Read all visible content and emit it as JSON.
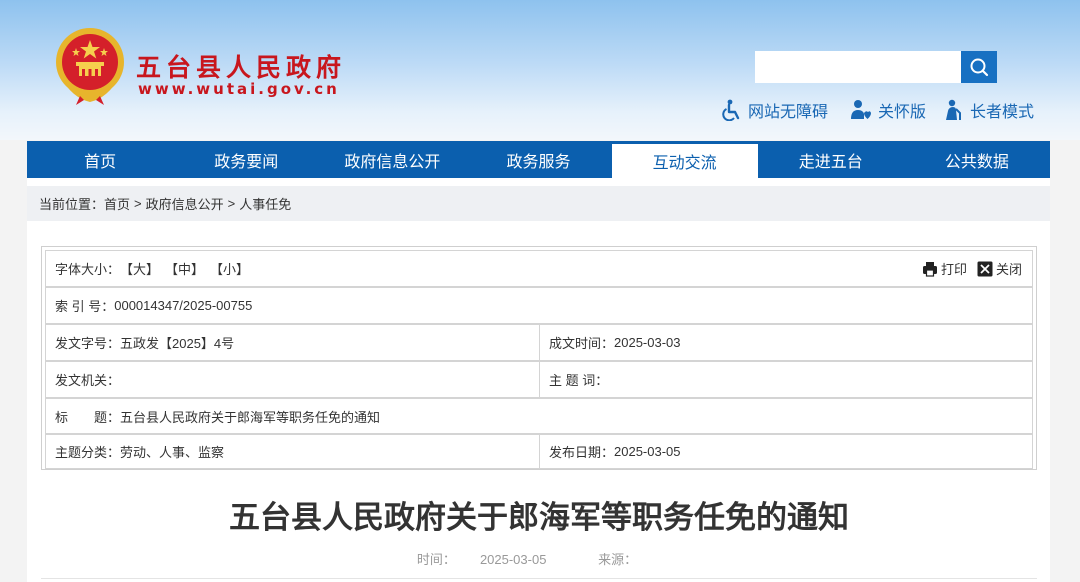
{
  "site": {
    "title": "五台县人民政府",
    "url": "www.wutai.gov.cn"
  },
  "search": {
    "placeholder": "",
    "value": ""
  },
  "tools": [
    {
      "label": "网站无障碍",
      "icon": "accessibility-icon"
    },
    {
      "label": "关怀版",
      "icon": "care-mode-icon"
    },
    {
      "label": "长者模式",
      "icon": "elder-mode-icon"
    }
  ],
  "nav": {
    "items": [
      "首页",
      "政务要闻",
      "政府信息公开",
      "政务服务",
      "互动交流",
      "走进五台",
      "公共数据"
    ],
    "active_index": 4
  },
  "breadcrumb": {
    "prefix": "当前位置：",
    "items": [
      "首页",
      "政府信息公开",
      "人事任免"
    ],
    "separator": ">"
  },
  "info": {
    "font_size_label": "字体大小：",
    "font_sizes": [
      "【大】",
      "【中】",
      "【小】"
    ],
    "print_label": "打印",
    "close_label": "关闭",
    "index_label": "索 引 号：",
    "index_value": "000014347/2025-00755",
    "doc_no_label": "发文字号：",
    "doc_no_value": "五政发【2025】4号",
    "created_label": "成文时间：",
    "created_value": "2025-03-03",
    "issuer_label": "发文机关：",
    "issuer_value": "",
    "keywords_label": "主 题 词：",
    "keywords_value": "",
    "title_label": "标　　题：",
    "title_value": "五台县人民政府关于郎海军等职务任免的通知",
    "category_label": "主题分类：",
    "category_value": "劳动、人事、监察",
    "published_label": "发布日期：",
    "published_value": "2025-03-05"
  },
  "article": {
    "title": "五台县人民政府关于郎海军等职务任免的通知",
    "time_label": "时间：",
    "time_value": "2025-03-05",
    "source_label": "来源：",
    "source_value": ""
  },
  "colors": {
    "brand_red": "#c8161d",
    "nav_blue": "#0b5fae",
    "search_blue": "#1770c2",
    "link_blue": "#1a68b4"
  }
}
